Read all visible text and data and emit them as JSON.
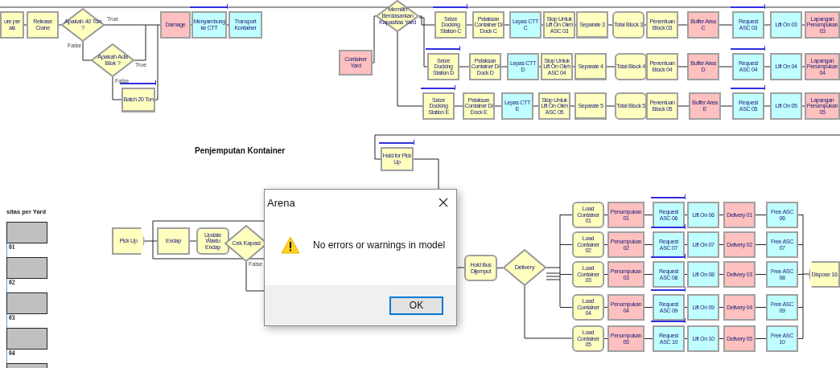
{
  "section_title": "Penjemputan Kontainer",
  "modules": [
    {
      "label": "ure per als",
      "kind": "process",
      "color": "#ffffc0"
    },
    {
      "label": "Release Crane",
      "kind": "process",
      "color": "#ffffc0"
    },
    {
      "label": "Apakah 40 Ton ?",
      "kind": "decide",
      "color": "#ffffc0"
    },
    {
      "label": "Apakah Ada Blok ?",
      "kind": "decide",
      "color": "#ffffc0"
    },
    {
      "label": "Batch 20 Ton",
      "kind": "batch",
      "color": "#ffffc0",
      "queue": true
    },
    {
      "label": "Damage",
      "kind": "process",
      "color": "#ffc0c0"
    },
    {
      "label": "Menyambung ke CTT",
      "kind": "process",
      "color": "#c0ffff",
      "queue": true
    },
    {
      "label": "Transport Kontainer",
      "kind": "process",
      "color": "#c0ffff"
    },
    {
      "label": "Memilih Berdasarkan Kapasitas Yard",
      "kind": "decide",
      "color": "#ffffc0"
    },
    {
      "label": "Container Yard",
      "kind": "process",
      "color": "#ffc0c0"
    },
    {
      "label": "Seize Docking Station C",
      "kind": "process",
      "color": "#ffffc0",
      "queue": true
    },
    {
      "label": "Pelaksan Container Di Dock C",
      "kind": "process",
      "color": "#ffffc0"
    },
    {
      "label": "Lepas CTT C",
      "kind": "process",
      "color": "#c0ffff"
    },
    {
      "label": "Stop Untuk Lift On Oleh ASC 03",
      "kind": "process",
      "color": "#ffffc0"
    },
    {
      "label": "Separate 3",
      "kind": "batch",
      "color": "#ffffc0"
    },
    {
      "label": "Total Block 3",
      "kind": "hold",
      "color": "#ffffc0"
    },
    {
      "label": "Penentuan Block 03",
      "kind": "process",
      "color": "#ffffc0"
    },
    {
      "label": "Buffer Area C",
      "kind": "process",
      "color": "#ffc0c0"
    },
    {
      "label": "Request ASC 03",
      "kind": "process",
      "color": "#c0ffff",
      "queue": true
    },
    {
      "label": "Lift On 03",
      "kind": "process",
      "color": "#c0ffff"
    },
    {
      "label": "Lapangan Penumpukan 03",
      "kind": "process",
      "color": "#ffc0c0"
    },
    {
      "label": "Seize Docking Station D",
      "kind": "process",
      "color": "#ffffc0",
      "queue": true
    },
    {
      "label": "Pelaksan Container Di Dock D",
      "kind": "process",
      "color": "#ffffc0"
    },
    {
      "label": "Lepas CTT D",
      "kind": "process",
      "color": "#c0ffff"
    },
    {
      "label": "Stop Untuk Lift On Oleh ASC 04",
      "kind": "process",
      "color": "#ffffc0"
    },
    {
      "label": "Separate 4",
      "kind": "batch",
      "color": "#ffffc0"
    },
    {
      "label": "Total Block 4",
      "kind": "hold",
      "color": "#ffffc0"
    },
    {
      "label": "Penentuan Block 04",
      "kind": "process",
      "color": "#ffffc0"
    },
    {
      "label": "Buffer Area D",
      "kind": "process",
      "color": "#ffc0c0"
    },
    {
      "label": "Request ASC 04",
      "kind": "process",
      "color": "#c0ffff",
      "queue": true
    },
    {
      "label": "Lift On 04",
      "kind": "process",
      "color": "#c0ffff"
    },
    {
      "label": "Lapangan Penumpukan 04",
      "kind": "process",
      "color": "#ffc0c0"
    },
    {
      "label": "Seize Docking Station E",
      "kind": "process",
      "color": "#ffffc0",
      "queue": true
    },
    {
      "label": "Pelaksan Container Di Dock E",
      "kind": "process",
      "color": "#ffffc0"
    },
    {
      "label": "Lepas CTT E",
      "kind": "process",
      "color": "#c0ffff"
    },
    {
      "label": "Stop Untuk Lift On Oleh ASC 05",
      "kind": "process",
      "color": "#ffffc0"
    },
    {
      "label": "Separate 5",
      "kind": "batch",
      "color": "#ffffc0"
    },
    {
      "label": "Total Block 5",
      "kind": "hold",
      "color": "#ffffc0"
    },
    {
      "label": "Penentuan Block 05",
      "kind": "process",
      "color": "#ffffc0"
    },
    {
      "label": "Buffer Area E",
      "kind": "process",
      "color": "#ffc0c0"
    },
    {
      "label": "Request ASC 05",
      "kind": "process",
      "color": "#c0ffff",
      "queue": true
    },
    {
      "label": "Lift On 05",
      "kind": "process",
      "color": "#c0ffff"
    },
    {
      "label": "Lapangan Penumpukan 05",
      "kind": "process",
      "color": "#ffc0c0"
    },
    {
      "label": "Hold for Pick Up",
      "kind": "process",
      "color": "#ffffc0",
      "queue": true
    },
    {
      "label": "Pick Up",
      "kind": "create",
      "color": "#ffffc0"
    },
    {
      "label": "Endap",
      "kind": "process",
      "color": "#ffffc0"
    },
    {
      "label": "Update Waktu Endap",
      "kind": "hold",
      "color": "#ffffc0"
    },
    {
      "label": "Cek Kapasi",
      "kind": "decide",
      "color": "#ffffc0"
    },
    {
      "label": "Hold Bus Dijemput",
      "kind": "hold",
      "color": "#ffffc0"
    },
    {
      "label": "Delivery",
      "kind": "decide",
      "color": "#ffffc0"
    },
    {
      "label": "Load Container 01",
      "kind": "hold",
      "color": "#ffffc0"
    },
    {
      "label": "Penumpukan 01",
      "kind": "process",
      "color": "#ffc0c0"
    },
    {
      "label": "Request ASC 06",
      "kind": "process",
      "color": "#c0ffff",
      "queue": true
    },
    {
      "label": "Lift On 06",
      "kind": "process",
      "color": "#c0ffff"
    },
    {
      "label": "Delivery 01",
      "kind": "process",
      "color": "#ffc0c0"
    },
    {
      "label": "Free ASC 06",
      "kind": "process",
      "color": "#c0ffff"
    },
    {
      "label": "Load Container 02",
      "kind": "hold",
      "color": "#ffffc0"
    },
    {
      "label": "Penumpukan 02",
      "kind": "process",
      "color": "#ffc0c0"
    },
    {
      "label": "Request ASC 07",
      "kind": "process",
      "color": "#c0ffff",
      "queue": true
    },
    {
      "label": "Lift On 07",
      "kind": "process",
      "color": "#c0ffff"
    },
    {
      "label": "Delivery 02",
      "kind": "process",
      "color": "#ffc0c0"
    },
    {
      "label": "Free ASC 07",
      "kind": "process",
      "color": "#c0ffff"
    },
    {
      "label": "Load Container 03",
      "kind": "hold",
      "color": "#ffffc0"
    },
    {
      "label": "Penumpukan 03",
      "kind": "process",
      "color": "#ffc0c0"
    },
    {
      "label": "Request ASC 08",
      "kind": "process",
      "color": "#c0ffff",
      "queue": true
    },
    {
      "label": "Lift On 08",
      "kind": "process",
      "color": "#c0ffff"
    },
    {
      "label": "Delivery 03",
      "kind": "process",
      "color": "#ffc0c0"
    },
    {
      "label": "Free ASC 08",
      "kind": "process",
      "color": "#c0ffff"
    },
    {
      "label": "Load Container 04",
      "kind": "hold",
      "color": "#ffffc0"
    },
    {
      "label": "Penumpukan 04",
      "kind": "process",
      "color": "#ffc0c0"
    },
    {
      "label": "Request ASC 09",
      "kind": "process",
      "color": "#c0ffff",
      "queue": true
    },
    {
      "label": "Lift On 09",
      "kind": "process",
      "color": "#c0ffff"
    },
    {
      "label": "Delivery 04",
      "kind": "process",
      "color": "#ffc0c0"
    },
    {
      "label": "Free ASC 09",
      "kind": "process",
      "color": "#c0ffff"
    },
    {
      "label": "Load Container 05",
      "kind": "hold",
      "color": "#ffffc0"
    },
    {
      "label": "Penumpukan 05",
      "kind": "process",
      "color": "#ffc0c0"
    },
    {
      "label": "Request ASC 10",
      "kind": "process",
      "color": "#c0ffff",
      "queue": true
    },
    {
      "label": "Lift On 10",
      "kind": "process",
      "color": "#c0ffff"
    },
    {
      "label": "Delivery 05",
      "kind": "process",
      "color": "#ffc0c0"
    },
    {
      "label": "Free ASC 10",
      "kind": "process",
      "color": "#c0ffff"
    },
    {
      "label": "Dispose 16",
      "kind": "dispose",
      "color": "#ffffc0"
    }
  ],
  "branch_labels": [
    "True",
    "False",
    "True",
    "False",
    "False"
  ],
  "capacity_panel": {
    "title": "sitas per Yard",
    "gauges": [
      {
        "kind": "gauge",
        "label": "01"
      },
      {
        "kind": "gauge",
        "label": "02"
      },
      {
        "kind": "gauge",
        "label": "03"
      },
      {
        "kind": "gauge",
        "label": "04"
      },
      {
        "kind": "gauge"
      }
    ]
  },
  "dialog": {
    "title": "Arena",
    "message": "No errors or warnings in model",
    "button": "OK"
  }
}
